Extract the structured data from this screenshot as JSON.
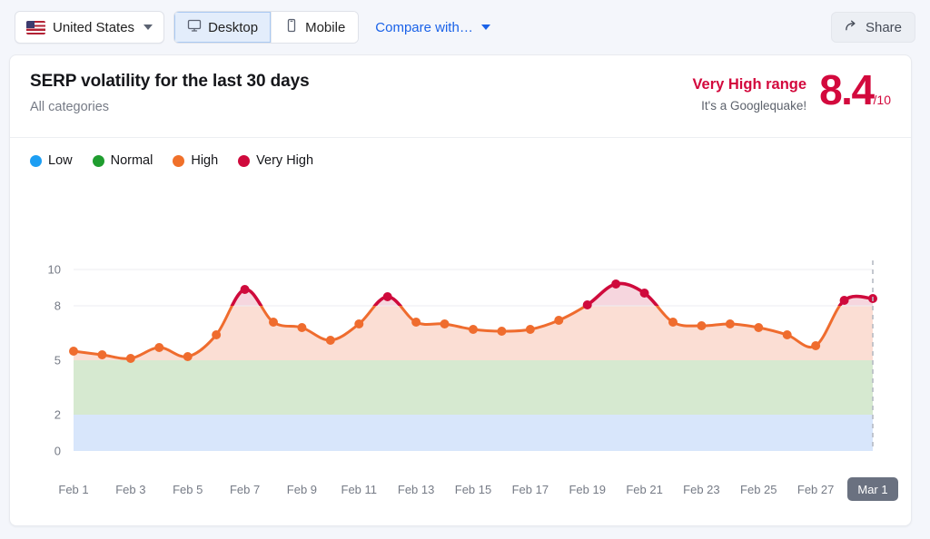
{
  "toolbar": {
    "country": {
      "label": "United States",
      "icon": "us-flag-icon",
      "chevron": "chevron-down-icon"
    },
    "devices": [
      {
        "label": "Desktop",
        "icon": "desktop-icon",
        "active": true
      },
      {
        "label": "Mobile",
        "icon": "mobile-icon",
        "active": false
      }
    ],
    "compare": {
      "label": "Compare with…",
      "chevron": "chevron-down-icon"
    },
    "share": {
      "label": "Share",
      "icon": "share-arrow-icon"
    }
  },
  "card": {
    "title": "SERP volatility for the last 30 days",
    "subtitle": "All categories",
    "score": {
      "range_label": "Very High range",
      "range_note": "It's a Googlequake!",
      "value": "8.4",
      "denominator": "/10",
      "color": "#d3093d"
    }
  },
  "legend": [
    {
      "label": "Low",
      "color": "#1c9ef3"
    },
    {
      "label": "Normal",
      "color": "#1f9d2f"
    },
    {
      "label": "High",
      "color": "#f0702a"
    },
    {
      "label": "Very High",
      "color": "#cf0a3c"
    }
  ],
  "chart_data": {
    "type": "line",
    "title": "SERP volatility for the last 30 days",
    "xlabel": "",
    "ylabel": "",
    "ylim": [
      0,
      10
    ],
    "yticks": [
      0,
      2,
      5,
      8,
      10
    ],
    "grid": true,
    "legend_position": "top-left",
    "x": [
      "Feb 1",
      "Feb 2",
      "Feb 3",
      "Feb 4",
      "Feb 5",
      "Feb 6",
      "Feb 7",
      "Feb 8",
      "Feb 9",
      "Feb 10",
      "Feb 11",
      "Feb 12",
      "Feb 13",
      "Feb 14",
      "Feb 15",
      "Feb 16",
      "Feb 17",
      "Feb 18",
      "Feb 19",
      "Feb 20",
      "Feb 21",
      "Feb 22",
      "Feb 23",
      "Feb 24",
      "Feb 25",
      "Feb 26",
      "Feb 27",
      "Feb 28",
      "Mar 1"
    ],
    "xtick_labels": [
      "Feb 1",
      "Feb 3",
      "Feb 5",
      "Feb 7",
      "Feb 9",
      "Feb 11",
      "Feb 13",
      "Feb 15",
      "Feb 17",
      "Feb 19",
      "Feb 21",
      "Feb 23",
      "Feb 25",
      "Feb 27",
      "Mar 1"
    ],
    "highlighted_xtick": "Mar 1",
    "series": [
      {
        "name": "SERP volatility",
        "values": [
          5.5,
          5.3,
          5.1,
          5.7,
          5.2,
          6.4,
          8.9,
          7.1,
          6.8,
          6.1,
          7.0,
          8.5,
          7.1,
          7.0,
          6.7,
          6.6,
          6.7,
          7.2,
          8.05,
          9.2,
          8.7,
          7.1,
          6.9,
          7.0,
          6.8,
          6.4,
          5.8,
          8.3,
          8.4
        ]
      }
    ],
    "bands": [
      {
        "name": "Low",
        "range": [
          0,
          2
        ],
        "color": "#d8e6fb"
      },
      {
        "name": "Normal",
        "range": [
          2,
          5
        ],
        "color": "#d6e9d0"
      },
      {
        "name": "High",
        "range": [
          5,
          8
        ],
        "color": "#fbded4"
      },
      {
        "name": "Very High",
        "range": [
          8,
          10
        ],
        "color": "#f6d6de"
      }
    ],
    "line_colors": {
      "high": "#ef6c2e",
      "very_high": "#cf0a3c"
    },
    "very_high_threshold": 8
  }
}
